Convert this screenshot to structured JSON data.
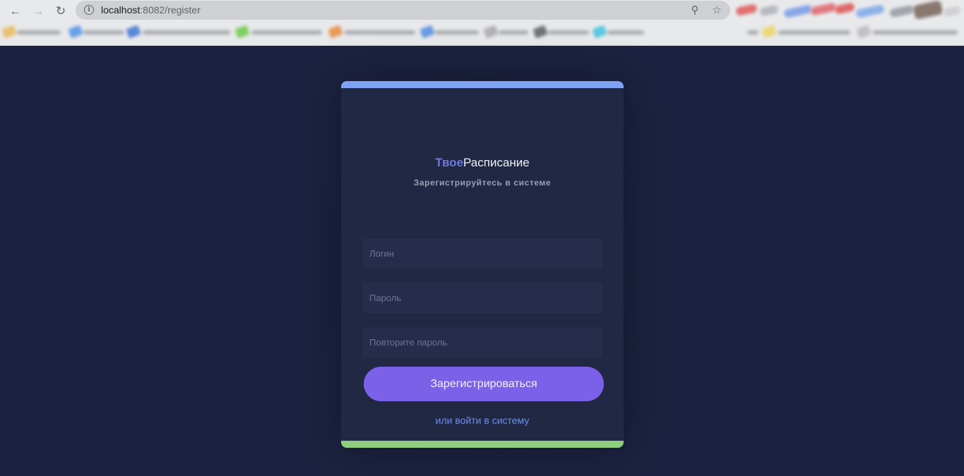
{
  "browser": {
    "url_host": "localhost",
    "url_rest": ":8082/register",
    "icons": [
      "back-arrow-icon",
      "forward-arrow-icon",
      "reload-icon",
      "info-icon",
      "key-icon",
      "star-icon"
    ]
  },
  "app": {
    "brand_accent": "Твое",
    "brand_rest": "Расписание",
    "subtitle": "Зарегистрируйтесь в системе"
  },
  "form": {
    "login_placeholder": "Логин",
    "password_placeholder": "Пароль",
    "repeat_password_placeholder": "Повторите пароль",
    "submit_label": "Зарегистрироваться",
    "login_link": "или войти в систему"
  },
  "colors": {
    "page_background": "#1c2340",
    "card_background": "#212843",
    "card_top_bar": "#7fa3f2",
    "card_bottom_bar": "#8fcf7f",
    "button": "#7b60e8",
    "link": "#6e8ee8",
    "brand_accent": "#6c78e0"
  }
}
